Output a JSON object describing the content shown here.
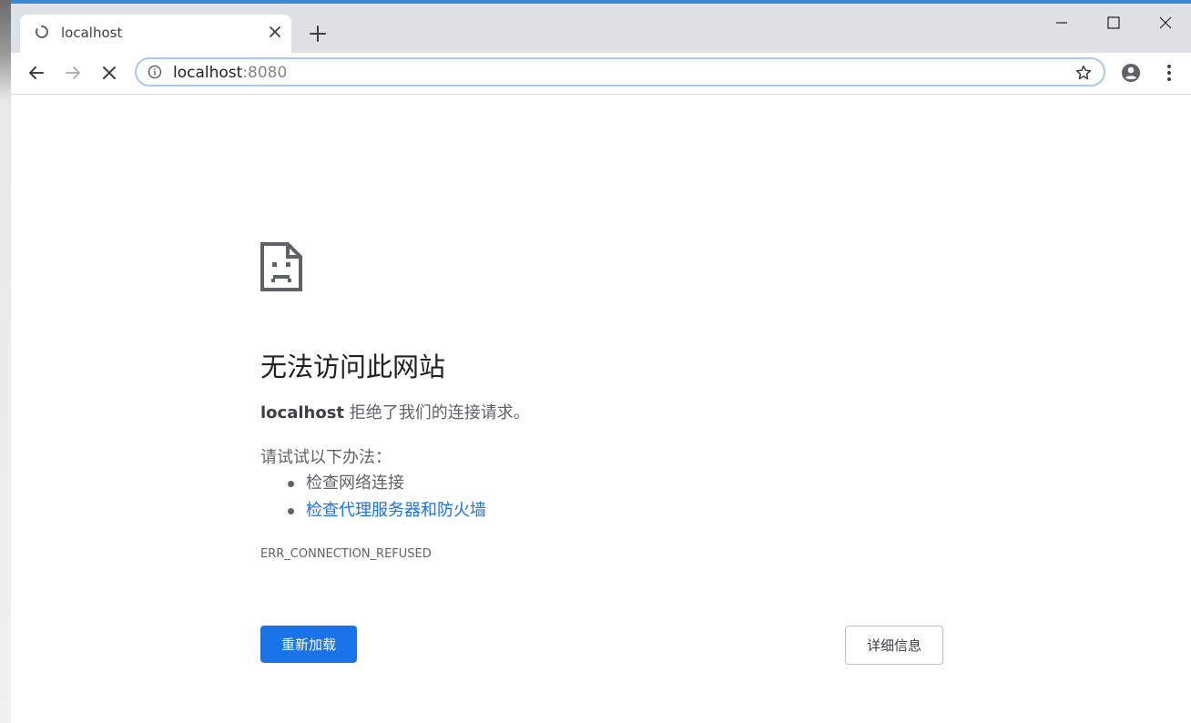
{
  "tab": {
    "title": "localhost"
  },
  "omnibox": {
    "host": "localhost",
    "port": ":8080"
  },
  "error": {
    "heading": "无法访问此网站",
    "host_bold": "localhost",
    "message": " 拒绝了我们的连接请求。",
    "suggest_label": "请试试以下办法：",
    "suggestions": [
      {
        "label": "检查网络连接",
        "is_link": false
      },
      {
        "label": "检查代理服务器和防火墙",
        "is_link": true
      }
    ],
    "code": "ERR_CONNECTION_REFUSED"
  },
  "buttons": {
    "reload": "重新加载",
    "details": "详细信息"
  },
  "colors": {
    "accent": "#1a73e8",
    "titlebar": "#dee1e6",
    "omnibox_focus": "#a8c7fa"
  },
  "icons": {
    "spinner": "loading-spinner-icon",
    "close": "close-icon",
    "new_tab": "plus-icon",
    "back": "arrow-left-icon",
    "forward": "arrow-right-icon",
    "stop": "stop-icon",
    "info": "info-icon",
    "star": "star-icon",
    "account": "account-icon",
    "menu": "kebab-menu-icon",
    "error_page": "sad-document-icon"
  }
}
